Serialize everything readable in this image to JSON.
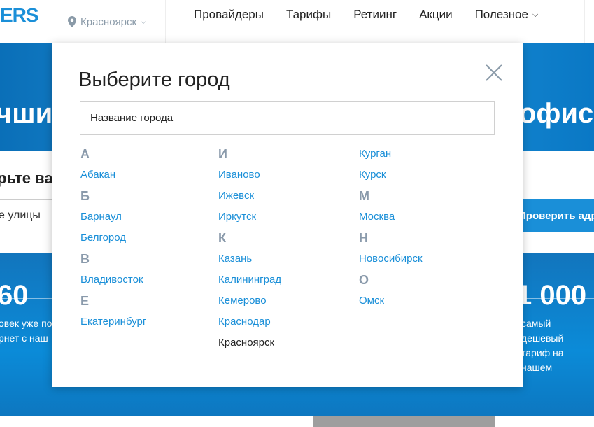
{
  "header": {
    "logo": "ERS",
    "city": "Красноярск",
    "nav": [
      "Провайдеры",
      "Тарифы",
      "Ретиинг",
      "Акции",
      "Полезное"
    ]
  },
  "page": {
    "hero_left": "чши",
    "hero_right": "офиса",
    "check_label": "рьте ва",
    "street_placeholder": "е улицы",
    "check_button": "Проверить адрес",
    "stat_left_num": "60",
    "stat_left_line1": "овек уже по",
    "stat_left_line2": "рнет с наш",
    "stat_right_num": "1 000",
    "stat_right_line1": "самый дешевый",
    "stat_right_line2": "тариф на нашем"
  },
  "modal": {
    "title": "Выберите город",
    "input_placeholder": "Название города",
    "columns": [
      [
        {
          "type": "letter",
          "text": "А"
        },
        {
          "type": "city",
          "text": "Абакан"
        },
        {
          "type": "letter",
          "text": "Б"
        },
        {
          "type": "city",
          "text": "Барнаул"
        },
        {
          "type": "city",
          "text": "Белгород"
        },
        {
          "type": "letter",
          "text": "В"
        },
        {
          "type": "city",
          "text": "Владивосток"
        },
        {
          "type": "letter",
          "text": "Е"
        },
        {
          "type": "city",
          "text": "Екатеринбург"
        }
      ],
      [
        {
          "type": "letter",
          "text": "И"
        },
        {
          "type": "city",
          "text": "Иваново"
        },
        {
          "type": "city",
          "text": "Ижевск"
        },
        {
          "type": "city",
          "text": "Иркутск"
        },
        {
          "type": "letter",
          "text": "К"
        },
        {
          "type": "city",
          "text": "Казань"
        },
        {
          "type": "city",
          "text": "Калининград"
        },
        {
          "type": "city",
          "text": "Кемерово"
        },
        {
          "type": "city",
          "text": "Краснодар"
        },
        {
          "type": "city",
          "text": "Красноярск",
          "active": true
        }
      ],
      [
        {
          "type": "city",
          "text": "Курган"
        },
        {
          "type": "city",
          "text": "Курск"
        },
        {
          "type": "letter",
          "text": "М"
        },
        {
          "type": "city",
          "text": "Москва"
        },
        {
          "type": "letter",
          "text": "Н"
        },
        {
          "type": "city",
          "text": "Новосибирск"
        },
        {
          "type": "letter",
          "text": "О"
        },
        {
          "type": "city",
          "text": "Омск"
        }
      ]
    ]
  },
  "colors": {
    "link": "#1a8fd8",
    "letter": "#8a9aab",
    "brand": "#1a8fd8"
  }
}
